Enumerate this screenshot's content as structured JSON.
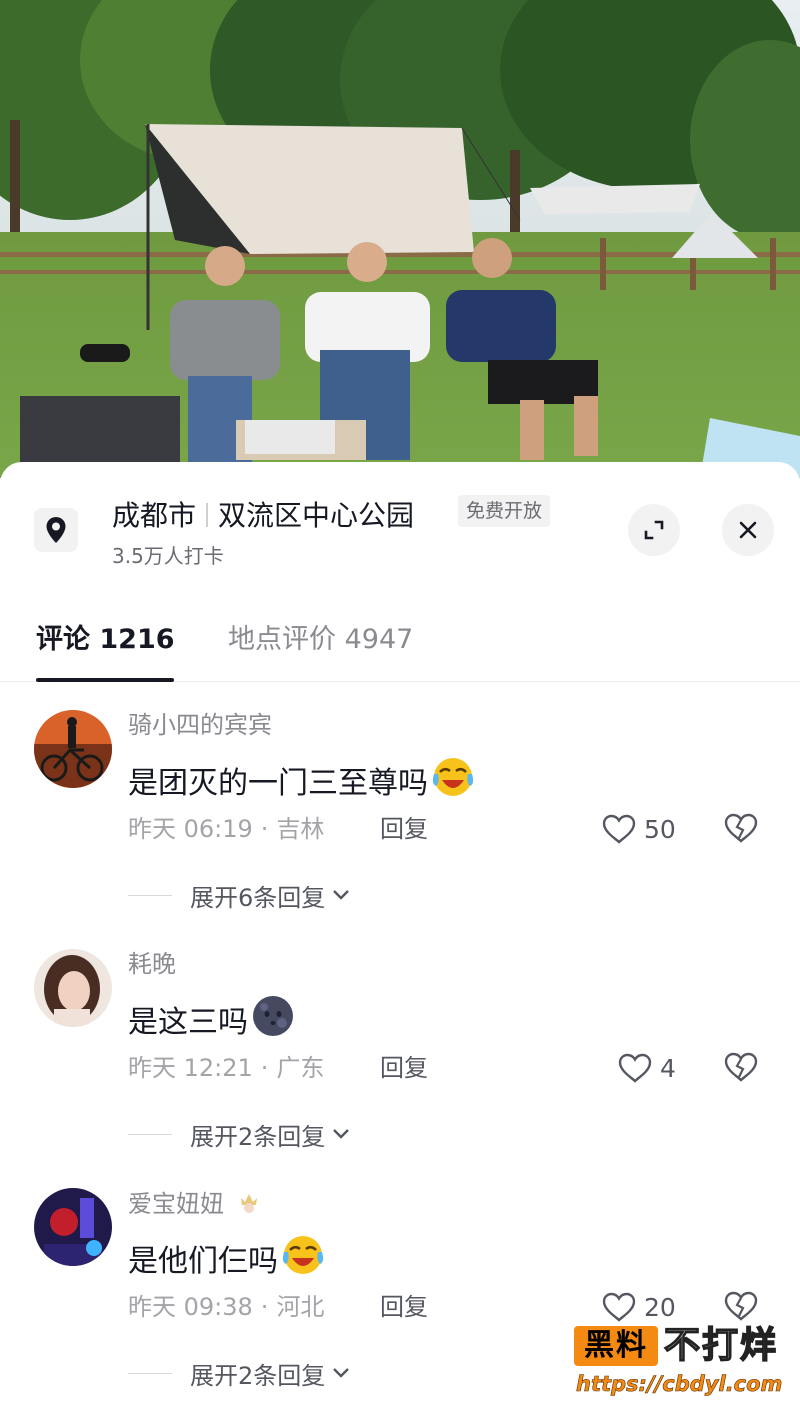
{
  "location": {
    "city": "成都市",
    "name": "双流区中心公园",
    "tag": "免费开放",
    "checkins": "3.5万人打卡"
  },
  "tabs": [
    {
      "label": "评论 1216",
      "active": true
    },
    {
      "label": "地点评价 4947",
      "active": false
    }
  ],
  "comments": [
    {
      "username": "骑小四的宾宾",
      "text": "是团灭的一门三至尊吗",
      "emoji": "laughing-crying-icon",
      "time": "昨天 06:19",
      "region": "吉林",
      "reply_label": "回复",
      "likes": "50",
      "expand_label": "展开6条回复"
    },
    {
      "username": "耗晚",
      "text": "是这三吗",
      "emoji": "moon-face-icon",
      "time": "昨天 12:21",
      "region": "广东",
      "reply_label": "回复",
      "likes": "4",
      "expand_label": "展开2条回复"
    },
    {
      "username": "爱宝妞妞",
      "text": "是他们仨吗",
      "emoji": "laughing-crying-icon",
      "time": "昨天 09:38",
      "region": "河北",
      "reply_label": "回复",
      "likes": "20",
      "expand_label": "展开2条回复"
    }
  ],
  "watermark": {
    "box_text": "黑料",
    "side_text": "不打烊",
    "url": "https://cbdyl.com"
  },
  "colors": {
    "text_primary": "#161823",
    "text_secondary": "#8a8b91",
    "watermark_orange": "#f58a12"
  }
}
